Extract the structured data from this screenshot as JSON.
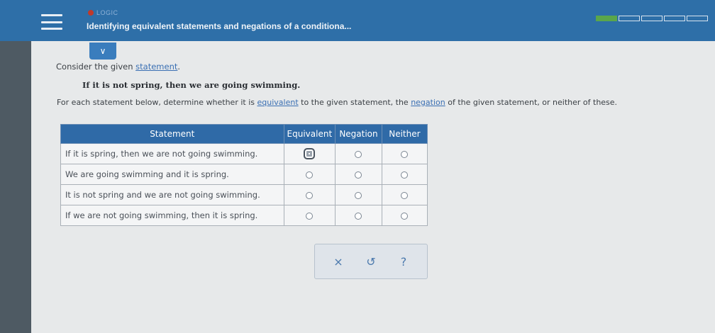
{
  "header": {
    "topic": "LOGIC",
    "title": "Identifying equivalent statements and negations of a conditiona...",
    "progress": {
      "completed": 1,
      "total": 5
    }
  },
  "problem": {
    "consider_prefix": "Consider the given ",
    "consider_link": "statement",
    "consider_suffix": ".",
    "statement": "If it is not spring, then we are going swimming.",
    "instruction_1": "For each statement below, determine whether it is ",
    "instruction_link_1": "equivalent",
    "instruction_2": " to the given statement, the ",
    "instruction_link_2": "negation",
    "instruction_3": " of the given statement, or neither of these."
  },
  "table": {
    "headers": [
      "Statement",
      "Equivalent",
      "Negation",
      "Neither"
    ],
    "rows": [
      {
        "text": "If it is spring, then we are not going swimming.",
        "selected": "Equivalent"
      },
      {
        "text": "We are going swimming and it is spring.",
        "selected": null
      },
      {
        "text": "It is not spring and we are not going swimming.",
        "selected": null
      },
      {
        "text": "If we are not going swimming, then it is spring.",
        "selected": null
      }
    ]
  },
  "actions": {
    "clear": "×",
    "undo": "↺",
    "help": "?"
  },
  "colors": {
    "header_bg": "#2e6fa8",
    "table_header_bg": "#2f6aa7",
    "progress_done": "#5aa64b",
    "link": "#3a6fb3"
  }
}
